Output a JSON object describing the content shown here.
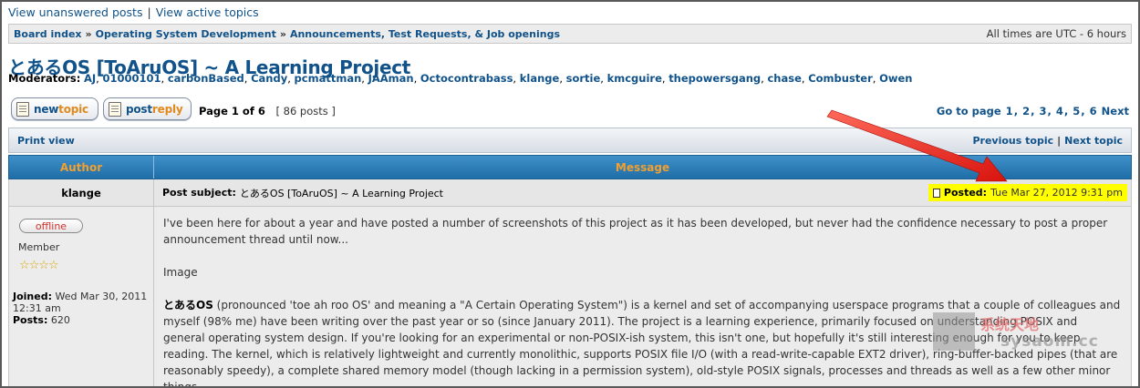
{
  "top_links": {
    "unanswered": "View unanswered posts",
    "separator": "|",
    "active": "View active topics"
  },
  "breadcrumb": {
    "items": [
      "Board index",
      "Operating System Development",
      "Announcements, Test Requests, & Job openings"
    ],
    "separator": "»",
    "timezone": "All times are UTC - 6 hours"
  },
  "topic": {
    "title": "とあるOS [ToAruOS] ~ A Learning Project",
    "moderators_label": "Moderators:",
    "moderators": [
      "AJ",
      "01000101",
      "carbonBased",
      "Candy",
      "pcmattman",
      "JAAman",
      "Octocontrabass",
      "klange",
      "sortie",
      "kmcguire",
      "thepowersgang",
      "chase",
      "Combuster",
      "Owen"
    ]
  },
  "buttons": {
    "new_topic_a": "new",
    "new_topic_b": "topic",
    "post_reply_a": "post",
    "post_reply_b": "reply"
  },
  "pagination": {
    "page_text": "Page 1 of 6",
    "posts_count": "[ 86 posts ]",
    "goto_label": "Go to page",
    "pages": [
      "1",
      "2",
      "3",
      "4",
      "5",
      "6"
    ],
    "next": "Next"
  },
  "print_bar": {
    "print_view": "Print view",
    "previous_topic": "Previous topic",
    "separator": "|",
    "next_topic": "Next topic"
  },
  "table_header": {
    "author": "Author",
    "message": "Message"
  },
  "post": {
    "author": "klange",
    "subject_label": "Post subject:",
    "subject": "とあるOS [ToAruOS] ~ A Learning Project",
    "posted_label": "Posted:",
    "posted_date": "Tue Mar 27, 2012 9:31 pm",
    "status": "offline",
    "rank": "Member",
    "stars": "☆☆☆☆",
    "joined_label": "Joined:",
    "joined": "Wed Mar 30, 2011 12:31 am",
    "posts_label": "Posts:",
    "posts": "620",
    "para1": "I've been here for about a year and have posted a number of screenshots of this project as it has been developed, but never had the confidence necessary to post a proper announcement thread until now...",
    "para2": "Image",
    "para3_bold": "とあるOS",
    "para3": " (pronounced 'toe ah roo OS' and meaning a \"A Certain Operating System\") is a kernel and set of accompanying userspace programs that a couple of colleagues and myself (98% me) have been writing over the past year or so (since January 2011). The project is a learning experience, primarily focused on understanding POSIX and general operating system design. If you're looking for an experimental or non-POSIX-ish system, this isn't one, but hopefully it's still interesting enough for you to keep reading. The kernel, which is relatively lightweight and currently monolithic, supports POSIX file I/O (with a read-write-capable EXT2 driver), ring-buffer-backed pipes (that are reasonably speedy), a complete shared memory model (though lacking in a permission system), old-style POSIX signals, processes and threads as well as a few other minor things."
  },
  "watermark": {
    "line1": "系统天地",
    "line2": "sysaom.cc"
  },
  "colors": {
    "link": "#105289",
    "header_bg": "#2a7fbe",
    "header_text": "#f0a030",
    "highlight": "#ffff00",
    "arrow": "#e8201a"
  }
}
